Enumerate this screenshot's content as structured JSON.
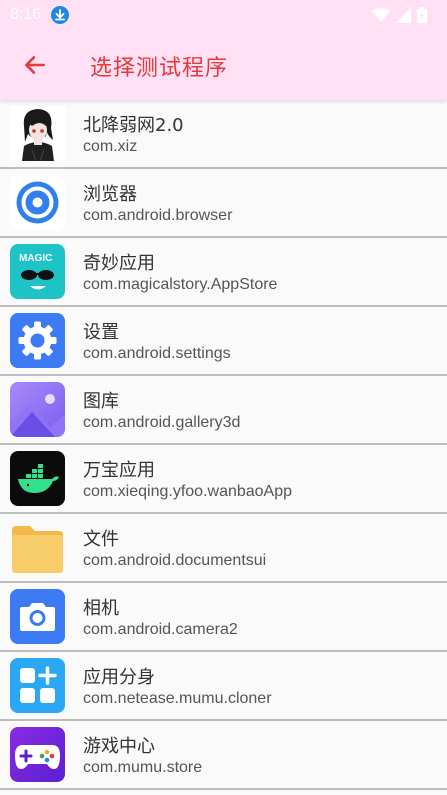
{
  "status_bar": {
    "time": "8:16",
    "icons": [
      "download-icon",
      "wifi-icon",
      "signal-icon",
      "battery-charging-icon"
    ]
  },
  "app_bar": {
    "title": "选择测试程序",
    "back_icon": "arrow-left-icon",
    "background": "#ffe0f4",
    "accent": "#e5393b"
  },
  "apps": [
    {
      "name": "北降弱网2.0",
      "package": "com.xiz",
      "icon": "anime-avatar-icon"
    },
    {
      "name": "浏览器",
      "package": "com.android.browser",
      "icon": "browser-icon"
    },
    {
      "name": "奇妙应用",
      "package": "com.magicalstory.AppStore",
      "icon": "magic-app-icon",
      "icon_text": "MAGIC"
    },
    {
      "name": "设置",
      "package": "com.android.settings",
      "icon": "settings-gear-icon"
    },
    {
      "name": "图库",
      "package": "com.android.gallery3d",
      "icon": "gallery-icon"
    },
    {
      "name": "万宝应用",
      "package": "com.xieqing.yfoo.wanbaoApp",
      "icon": "docker-whale-icon"
    },
    {
      "name": "文件",
      "package": "com.android.documentsui",
      "icon": "folder-icon"
    },
    {
      "name": "相机",
      "package": "com.android.camera2",
      "icon": "camera-icon"
    },
    {
      "name": "应用分身",
      "package": "com.netease.mumu.cloner",
      "icon": "app-cloner-icon"
    },
    {
      "name": "游戏中心",
      "package": "com.mumu.store",
      "icon": "gamepad-icon"
    }
  ]
}
